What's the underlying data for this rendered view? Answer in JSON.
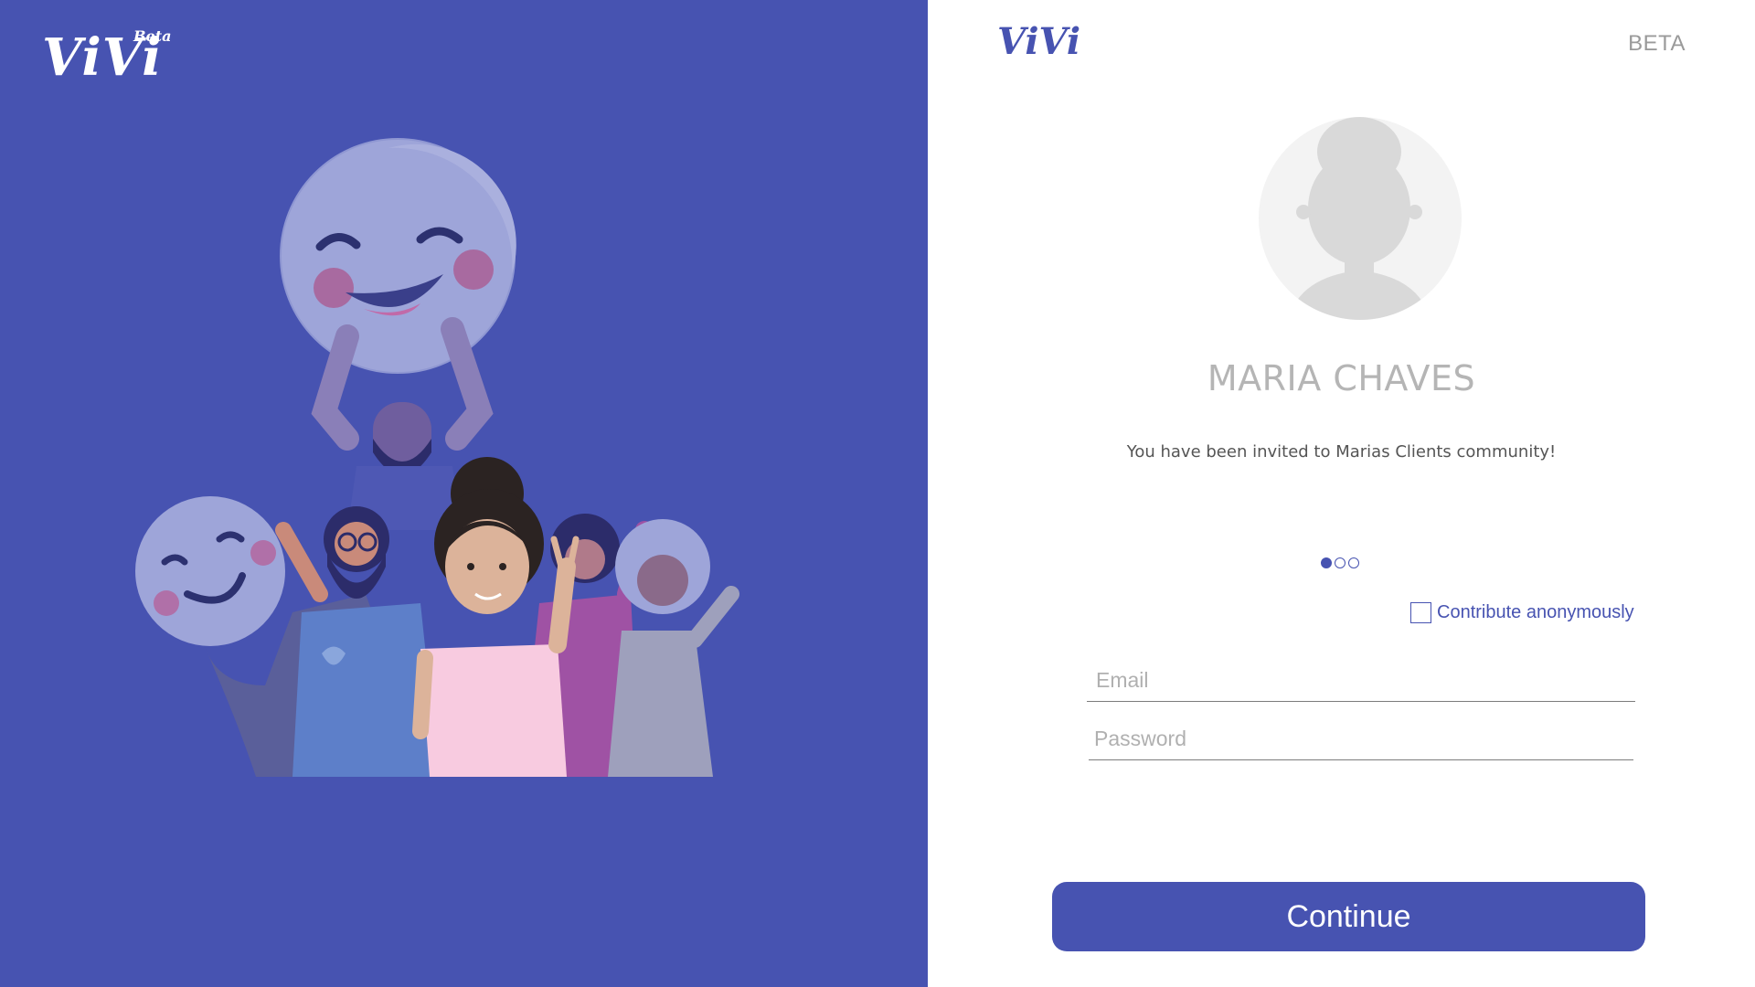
{
  "brand": {
    "name": "ViVi",
    "beta_small": "Beta",
    "beta_tag": "BETA",
    "accent": "#4753b1"
  },
  "profile": {
    "name": "MARIA CHAVES",
    "avatar_icon": "user-silhouette-icon",
    "invite_text": "You have been invited to Marias Clients community!"
  },
  "pager": {
    "current": 1,
    "total": 3
  },
  "form": {
    "anonymous_label": "Contribute anonymously",
    "anonymous_checked": false,
    "email_placeholder": "Email",
    "email_value": "",
    "password_placeholder": "Password",
    "password_value": "",
    "continue_label": "Continue"
  }
}
